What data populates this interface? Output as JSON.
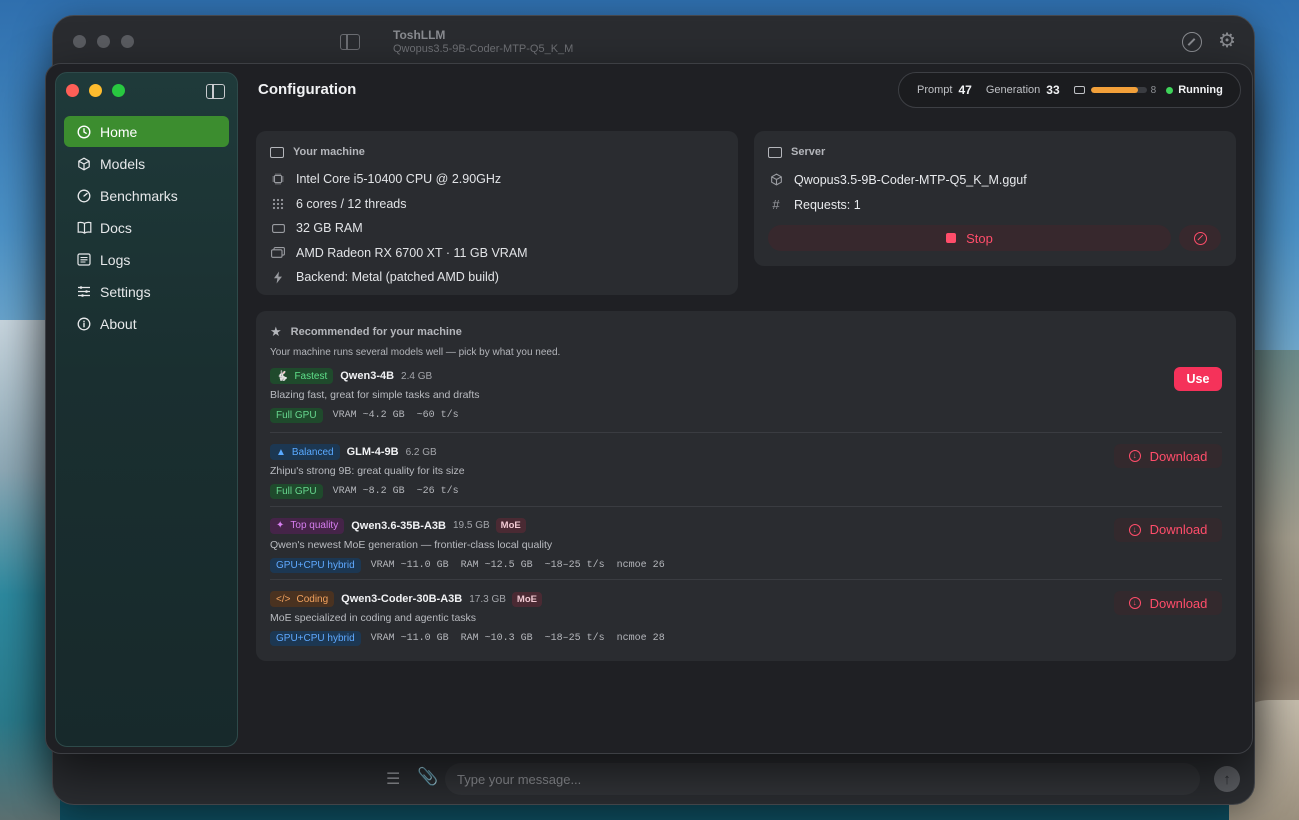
{
  "back_window": {
    "title": "ToshLLM",
    "subtitle": "Qwopus3.5-9B-Coder-MTP-Q5_K_M",
    "composer_placeholder": "Type your message..."
  },
  "sidebar": {
    "items": [
      {
        "label": "Home",
        "icon": "clock-icon",
        "active": true
      },
      {
        "label": "Models",
        "icon": "cube-icon"
      },
      {
        "label": "Benchmarks",
        "icon": "gauge-icon"
      },
      {
        "label": "Docs",
        "icon": "book-icon"
      },
      {
        "label": "Logs",
        "icon": "list-icon"
      },
      {
        "label": "Settings",
        "icon": "sliders-icon"
      },
      {
        "label": "About",
        "icon": "info-icon"
      }
    ]
  },
  "header": {
    "title": "Configuration",
    "prompt_label": "Prompt",
    "prompt_value": "47",
    "generation_label": "Generation",
    "generation_value": "33",
    "context_progress": 0.85,
    "context_tail": "8",
    "status": "Running",
    "status_color": "#3fd35a"
  },
  "machine": {
    "heading": "Your machine",
    "cpu": "Intel Core i5-10400 CPU @ 2.90GHz",
    "cores": "6 cores / 12 threads",
    "ram": "32 GB RAM",
    "gpu": "AMD Radeon RX 6700 XT · 11 GB VRAM",
    "backend": "Backend: Metal (patched AMD build)"
  },
  "server": {
    "heading": "Server",
    "model_file": "Qwopus3.5-9B-Coder-MTP-Q5_K_M.gguf",
    "requests": "Requests: 1",
    "stop_label": "Stop"
  },
  "recommended": {
    "heading": "Recommended for your machine",
    "subtitle": "Your machine runs several models well — pick by what you need.",
    "models": [
      {
        "tag": "Fastest",
        "name": "Qwen3-4B",
        "size": "2.4 GB",
        "moe": "",
        "desc": "Blazing fast, great for simple tasks and drafts",
        "fit": "Full GPU",
        "stats": "VRAM ~4.2 GB  ~60 t/s",
        "action": "Use"
      },
      {
        "tag": "Balanced",
        "name": "GLM-4-9B",
        "size": "6.2 GB",
        "moe": "",
        "desc": "Zhipu's strong 9B: great quality for its size",
        "fit": "Full GPU",
        "stats": "VRAM ~8.2 GB  ~26 t/s",
        "action": "Download"
      },
      {
        "tag": "Top quality",
        "name": "Qwen3.6-35B-A3B",
        "size": "19.5 GB",
        "moe": "MoE",
        "desc": "Qwen's newest MoE generation — frontier-class local quality",
        "fit": "GPU+CPU hybrid",
        "stats": "VRAM ~11.0 GB  RAM ~12.5 GB  ~18–25 t/s  ncmoe 26",
        "action": "Download"
      },
      {
        "tag": "Coding",
        "name": "Qwen3-Coder-30B-A3B",
        "size": "17.3 GB",
        "moe": "MoE",
        "desc": "MoE specialized in coding and agentic tasks",
        "fit": "GPU+CPU hybrid",
        "stats": "VRAM ~11.0 GB  RAM ~10.3 GB  ~18–25 t/s  ncmoe 28",
        "action": "Download"
      }
    ]
  },
  "colors": {
    "accent_green": "#3c8d2f",
    "accent_red": "#f5325a",
    "progress": "#f2a03a"
  }
}
